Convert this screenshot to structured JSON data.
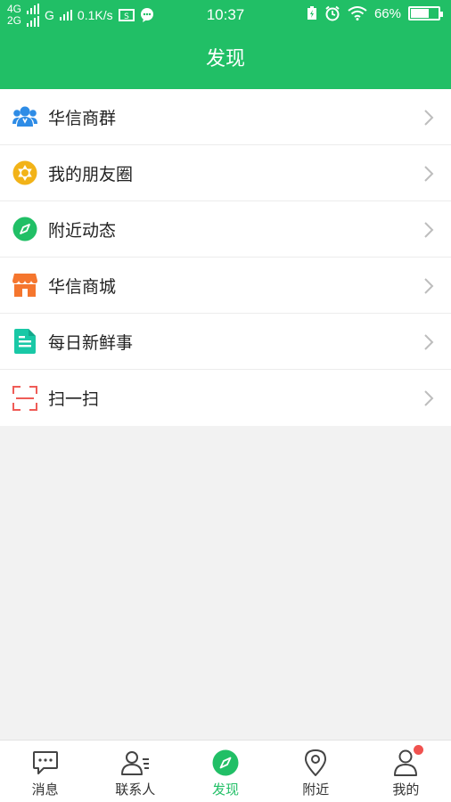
{
  "statusbar": {
    "net1": "4G",
    "net2": "2G",
    "net3": "G",
    "speed": "0.1K/s",
    "time": "10:37",
    "battery": "66%",
    "battery_level": 0.66
  },
  "header": {
    "title": "发现"
  },
  "menu": {
    "items": [
      {
        "label": "华信商群",
        "icon": "group-icon",
        "color": "#2e8ce6"
      },
      {
        "label": "我的朋友圈",
        "icon": "aperture-icon",
        "color": "#f2b318"
      },
      {
        "label": "附近动态",
        "icon": "compass-icon",
        "color": "#21bf66"
      },
      {
        "label": "华信商城",
        "icon": "store-icon",
        "color": "#f5762e"
      },
      {
        "label": "每日新鲜事",
        "icon": "document-icon",
        "color": "#19c8a6"
      },
      {
        "label": "扫一扫",
        "icon": "scan-icon",
        "color": "#ef5c57"
      }
    ]
  },
  "tabbar": {
    "tabs": [
      {
        "label": "消息",
        "icon": "message-icon"
      },
      {
        "label": "联系人",
        "icon": "contacts-icon"
      },
      {
        "label": "发现",
        "icon": "compass-icon",
        "active": true
      },
      {
        "label": "附近",
        "icon": "location-pin-icon"
      },
      {
        "label": "我的",
        "icon": "user-icon",
        "badge": true
      }
    ]
  },
  "colors": {
    "accent": "#21bf66",
    "badge": "#f0524f"
  }
}
